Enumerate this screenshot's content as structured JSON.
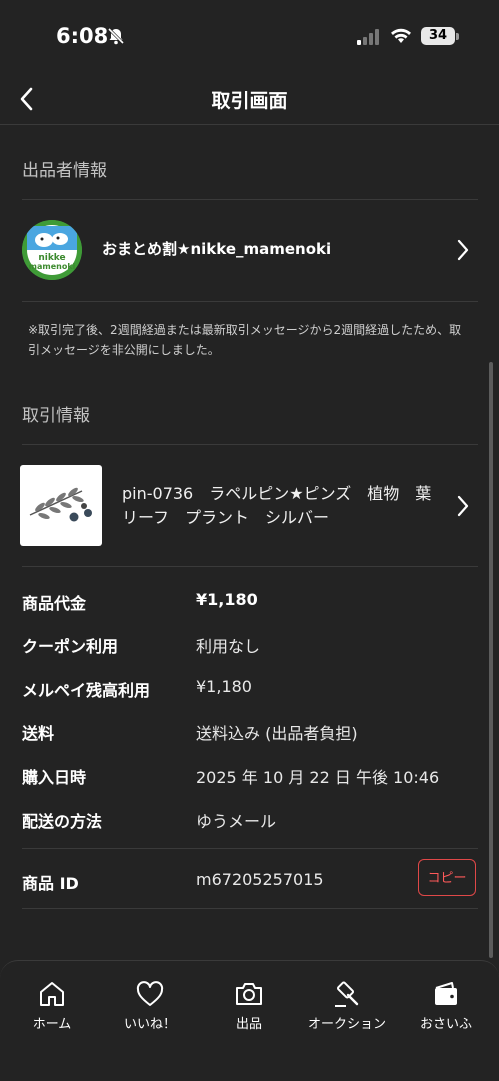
{
  "status_bar": {
    "time": "6:08",
    "battery": "34"
  },
  "nav": {
    "title": "取引画面"
  },
  "seller_section": {
    "heading": "出品者情報",
    "seller_name": "おまとめ割★nikke_mamenoki",
    "avatar_text_1": "nikke",
    "avatar_text_2": "mamenoki"
  },
  "notice": "※取引完了後、2週間経過または最新取引メッセージから2週間経過したため、取引メッセージを非公開にしました。",
  "transaction_section": {
    "heading": "取引情報",
    "item_title": "pin-0736　ラペルピン★ピンズ　植物　葉　リーフ　プラント　シルバー"
  },
  "details": [
    {
      "label": "商品代金",
      "value": "¥1,180"
    },
    {
      "label": "クーポン利用",
      "value": "利用なし"
    },
    {
      "label": "メルペイ残高利用",
      "value": "¥1,180"
    },
    {
      "label": "送料",
      "value": "送料込み (出品者負担)"
    },
    {
      "label": "購入日時",
      "value": "2025 年 10 月 22 日 午後 10:46"
    },
    {
      "label": "配送の方法",
      "value": "ゆうメール"
    }
  ],
  "item_id": {
    "label": "商品 ID",
    "value": "m67205257015",
    "copy_label": "コピー"
  },
  "tabbar": {
    "tabs": [
      {
        "label": "ホーム"
      },
      {
        "label": "いいね！"
      },
      {
        "label": "出品"
      },
      {
        "label": "オークション"
      },
      {
        "label": "おさいふ"
      }
    ]
  },
  "colors": {
    "background": "#232323",
    "accent_red": "#e04848"
  }
}
